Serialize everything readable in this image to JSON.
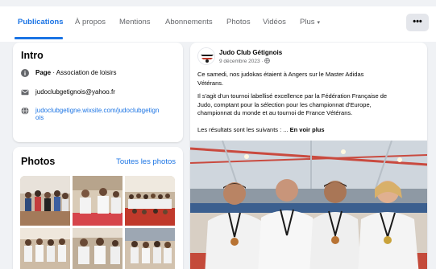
{
  "tabs": {
    "items": [
      "Publications",
      "À propos",
      "Mentions",
      "Abonnements",
      "Photos",
      "Vidéos",
      "Plus"
    ],
    "more_caret": "▾",
    "dots": "•••"
  },
  "intro": {
    "title": "Intro",
    "page_label": "Page",
    "page_category": " · Association de loisirs",
    "email": "judoclubgetignois@yahoo.fr",
    "website_line1": "judoclubgetigne.wixsite.com/judoclubgetign",
    "website_line2": "ois"
  },
  "photos": {
    "title": "Photos",
    "all_link": "Toutes les photos"
  },
  "post": {
    "author": "Judo Club Gétignois",
    "date": "9 décembre 2023 · ",
    "p1_line1": "Ce samedi, nos judokas étaient à Angers sur le Master Adidas",
    "p1_line2": "Vétérans.",
    "p2_line1": "Il s'agit d'un tournoi labellisé excellence par la Fédération Française de",
    "p2_line2": "Judo, comptant pour la sélection pour les championnat d'Europe,",
    "p2_line3": "championnat du monde et au tournoi de France Vétérans.",
    "p3": "Les résultats sont les suivants : ... ",
    "see_more": "En voir plus"
  },
  "colors": {
    "accent": "#1b74e4",
    "muted": "#65676b",
    "background": "#f0f2f5",
    "card": "#ffffff"
  }
}
